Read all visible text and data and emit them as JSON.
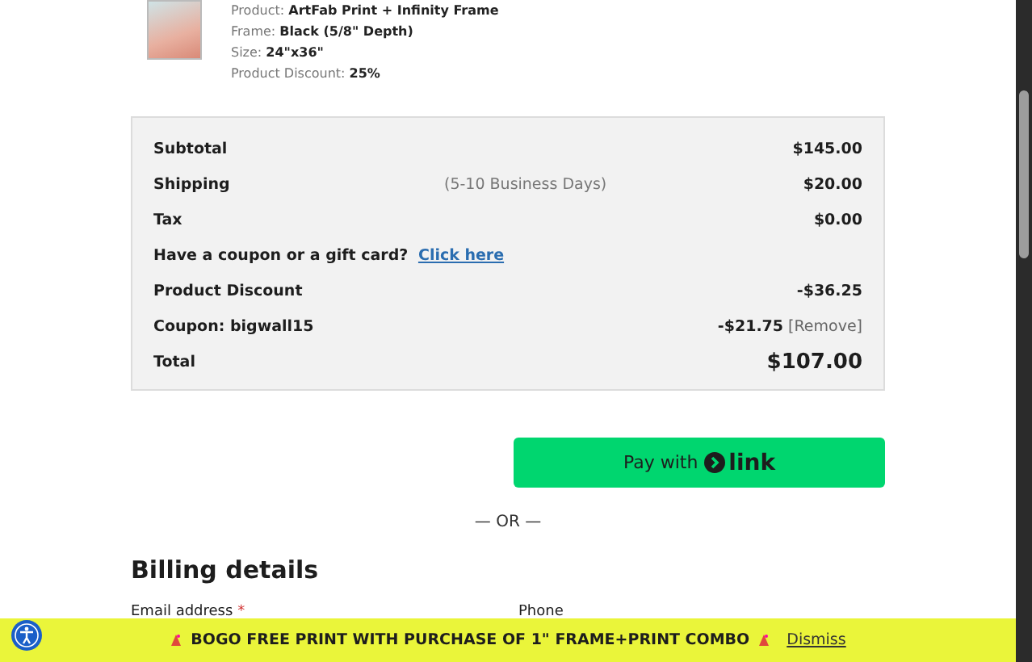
{
  "product": {
    "details": [
      {
        "label": "Product:",
        "value": "ArtFab Print + Infinity Frame"
      },
      {
        "label": "Frame:",
        "value": "Black (5/8\" Depth)"
      },
      {
        "label": "Size:",
        "value": "24\"x36\""
      },
      {
        "label": "Product Discount:",
        "value": "25%"
      }
    ]
  },
  "summary": {
    "rows": [
      {
        "kind": "line",
        "label": "Subtotal",
        "value": "$145.00"
      },
      {
        "kind": "line",
        "label": "Shipping",
        "note": "(5-10 Business Days)",
        "value": "$20.00"
      },
      {
        "kind": "line",
        "label": "Tax",
        "value": "$0.00"
      },
      {
        "kind": "coupon",
        "label": "Have a coupon or a gift card?",
        "link": "Click here"
      },
      {
        "kind": "line",
        "label": "Product Discount",
        "value": "-$36.25"
      },
      {
        "kind": "line",
        "label": "Coupon: bigwall15",
        "value": "-$21.75",
        "action": "[Remove]"
      },
      {
        "kind": "total",
        "label": "Total",
        "value": "$107.00"
      }
    ]
  },
  "pay_button": {
    "prefix": "Pay with",
    "brand": "link"
  },
  "divider": "— OR —",
  "billing": {
    "title": "Billing details",
    "fields": [
      {
        "label": "Email address",
        "required": true
      },
      {
        "label": "Phone",
        "required": false
      }
    ],
    "required_mark": "*"
  },
  "banner": {
    "text": "BOGO FREE PRINT WITH PURCHASE OF 1\" FRAME+PRINT COMBO",
    "dismiss": "Dismiss"
  }
}
